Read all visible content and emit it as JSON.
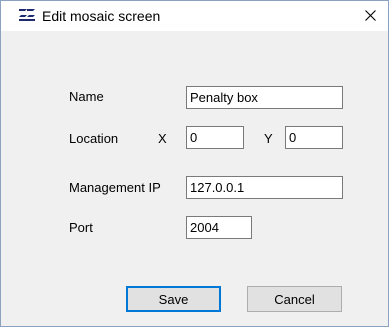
{
  "window": {
    "title": "Edit mosaic screen",
    "icon": "app-logo-icon",
    "close_icon": "close-icon"
  },
  "form": {
    "name": {
      "label": "Name",
      "value": "Penalty box"
    },
    "location": {
      "label": "Location",
      "x_label": "X",
      "x_value": "0",
      "y_label": "Y",
      "y_value": "0"
    },
    "management_ip": {
      "label": "Management IP",
      "value": "127.0.0.1"
    },
    "port": {
      "label": "Port",
      "value": "2004"
    }
  },
  "buttons": {
    "save_label": "Save",
    "cancel_label": "Cancel"
  },
  "colors": {
    "default_button_border": "#0078d7",
    "button_face": "#e1e1e1",
    "dialog_background": "#f0f0f0"
  }
}
